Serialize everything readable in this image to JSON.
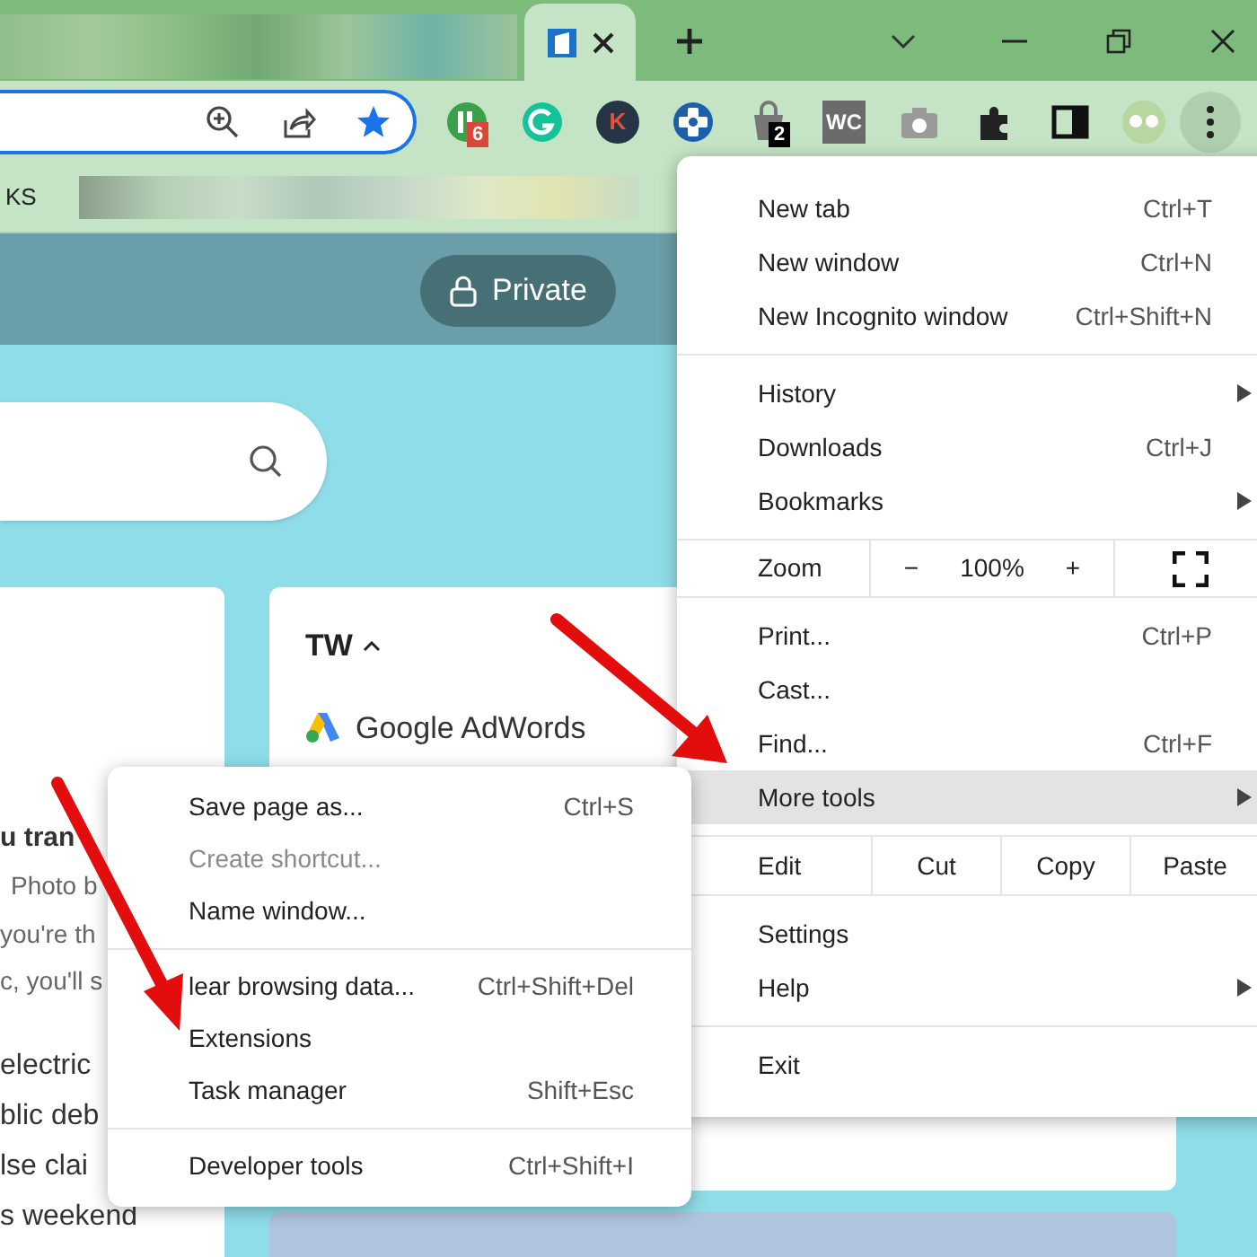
{
  "toolbar": {
    "extensions": [
      {
        "kind": "tile",
        "badge": "6"
      },
      {
        "kind": "ring"
      },
      {
        "kind": "letter",
        "letter": "K"
      },
      {
        "kind": "cross"
      },
      {
        "kind": "bag",
        "badge": "2"
      },
      {
        "kind": "square-letters",
        "letter": "WC"
      },
      {
        "kind": "camera"
      },
      {
        "kind": "puzzle"
      },
      {
        "kind": "side-panel"
      }
    ]
  },
  "bookmarks_bar": {
    "items": [
      "KS"
    ]
  },
  "page": {
    "private_button": "Private",
    "card": {
      "title": "TW",
      "links": [
        "Google AdWords"
      ]
    },
    "article_lines": [
      {
        "text": "u tran",
        "kind": "heading"
      },
      {
        "text": "Photo b",
        "kind": "caption"
      },
      {
        "text": "you're th",
        "kind": "body"
      },
      {
        "text": "c, you'll s",
        "kind": "body"
      },
      {
        "text": "electric",
        "kind": "headline"
      },
      {
        "text": "blic deb",
        "kind": "headline"
      },
      {
        "text": "lse clai",
        "kind": "headline"
      },
      {
        "text": "s weekend",
        "kind": "headline"
      }
    ]
  },
  "main_menu": {
    "sections": [
      {
        "items": [
          {
            "kind": "item",
            "label": "New tab",
            "shortcut": "Ctrl+T",
            "submenu": false,
            "selected": false
          },
          {
            "kind": "item",
            "label": "New window",
            "shortcut": "Ctrl+N",
            "submenu": false,
            "selected": false
          },
          {
            "kind": "item",
            "label": "New Incognito window",
            "shortcut": "Ctrl+Shift+N",
            "submenu": false,
            "selected": false
          }
        ]
      },
      {
        "items": [
          {
            "kind": "item",
            "label": "History",
            "submenu": true,
            "selected": false
          },
          {
            "kind": "item",
            "label": "Downloads",
            "shortcut": "Ctrl+J",
            "submenu": false,
            "selected": false
          },
          {
            "kind": "item",
            "label": "Bookmarks",
            "submenu": true,
            "selected": false
          }
        ]
      },
      {
        "items": [
          {
            "kind": "zoom",
            "label": "Zoom",
            "minus": "−",
            "value": "100%",
            "plus": "+"
          }
        ]
      },
      {
        "items": [
          {
            "kind": "item",
            "label": "Print...",
            "shortcut": "Ctrl+P",
            "submenu": false,
            "selected": false
          },
          {
            "kind": "item",
            "label": "Cast...",
            "submenu": false,
            "selected": false
          },
          {
            "kind": "item",
            "label": "Find...",
            "shortcut": "Ctrl+F",
            "submenu": false,
            "selected": false
          },
          {
            "kind": "item",
            "label": "More tools",
            "submenu": true,
            "selected": true
          }
        ]
      },
      {
        "items": [
          {
            "kind": "edit",
            "label": "Edit",
            "actions": [
              "Cut",
              "Copy",
              "Paste"
            ]
          }
        ]
      },
      {
        "items": [
          {
            "kind": "item",
            "label": "Settings",
            "submenu": false,
            "selected": false
          },
          {
            "kind": "item",
            "label": "Help",
            "submenu": true,
            "selected": false
          }
        ]
      },
      {
        "items": [
          {
            "kind": "item",
            "label": "Exit",
            "submenu": false,
            "selected": false
          }
        ]
      }
    ]
  },
  "more_tools_menu": {
    "sections": [
      {
        "items": [
          {
            "label": "Save page as...",
            "shortcut": "Ctrl+S",
            "disabled": false
          },
          {
            "label": "Create shortcut...",
            "disabled": true
          },
          {
            "label": "Name window...",
            "disabled": false
          }
        ]
      },
      {
        "items": [
          {
            "label": "lear browsing data...",
            "shortcut": "Ctrl+Shift+Del",
            "disabled": false
          },
          {
            "label": "Extensions",
            "disabled": false
          },
          {
            "label": "Task manager",
            "shortcut": "Shift+Esc",
            "disabled": false
          }
        ]
      },
      {
        "items": [
          {
            "label": "Developer tools",
            "shortcut": "Ctrl+Shift+I",
            "disabled": false
          }
        ]
      }
    ]
  }
}
